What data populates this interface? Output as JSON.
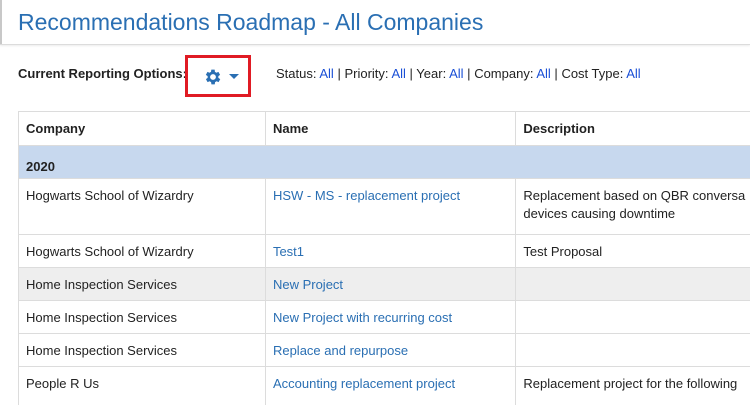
{
  "page": {
    "title": "Recommendations Roadmap - All Companies"
  },
  "options": {
    "label": "Current Reporting Options:",
    "filters": [
      {
        "name": "Status:",
        "value": "All"
      },
      {
        "name": "Priority:",
        "value": "All"
      },
      {
        "name": "Year:",
        "value": "All"
      },
      {
        "name": "Company:",
        "value": "All"
      },
      {
        "name": "Cost Type:",
        "value": "All"
      }
    ],
    "separator": "|"
  },
  "colors": {
    "title": "#2a6fb3",
    "link": "#2a6fb3",
    "filter_link": "#1a4fd6",
    "highlight_border": "#e01b24",
    "year_row": "#c7d8ee",
    "shaded_row": "#eeeeee"
  },
  "table": {
    "headers": [
      "Company",
      "Name",
      "Description"
    ],
    "year_group": "2020",
    "rows": [
      {
        "company": "Hogwarts School of Wizardry",
        "name": "HSW - MS - replacement project",
        "description_lines": [
          "Replacement based on QBR conversa",
          "devices causing downtime"
        ]
      },
      {
        "company": "Hogwarts School of Wizardry",
        "name": "Test1",
        "description_lines": [
          "Test Proposal"
        ]
      },
      {
        "company": "Home Inspection Services",
        "name": "New Project",
        "description_lines": [
          ""
        ]
      },
      {
        "company": "Home Inspection Services",
        "name": "New Project with recurring cost",
        "description_lines": [
          ""
        ]
      },
      {
        "company": "Home Inspection Services",
        "name": "Replace and repurpose",
        "description_lines": [
          ""
        ]
      },
      {
        "company": "People R Us",
        "name": "Accounting replacement project",
        "description_lines": [
          "Replacement project for the following"
        ]
      }
    ]
  }
}
